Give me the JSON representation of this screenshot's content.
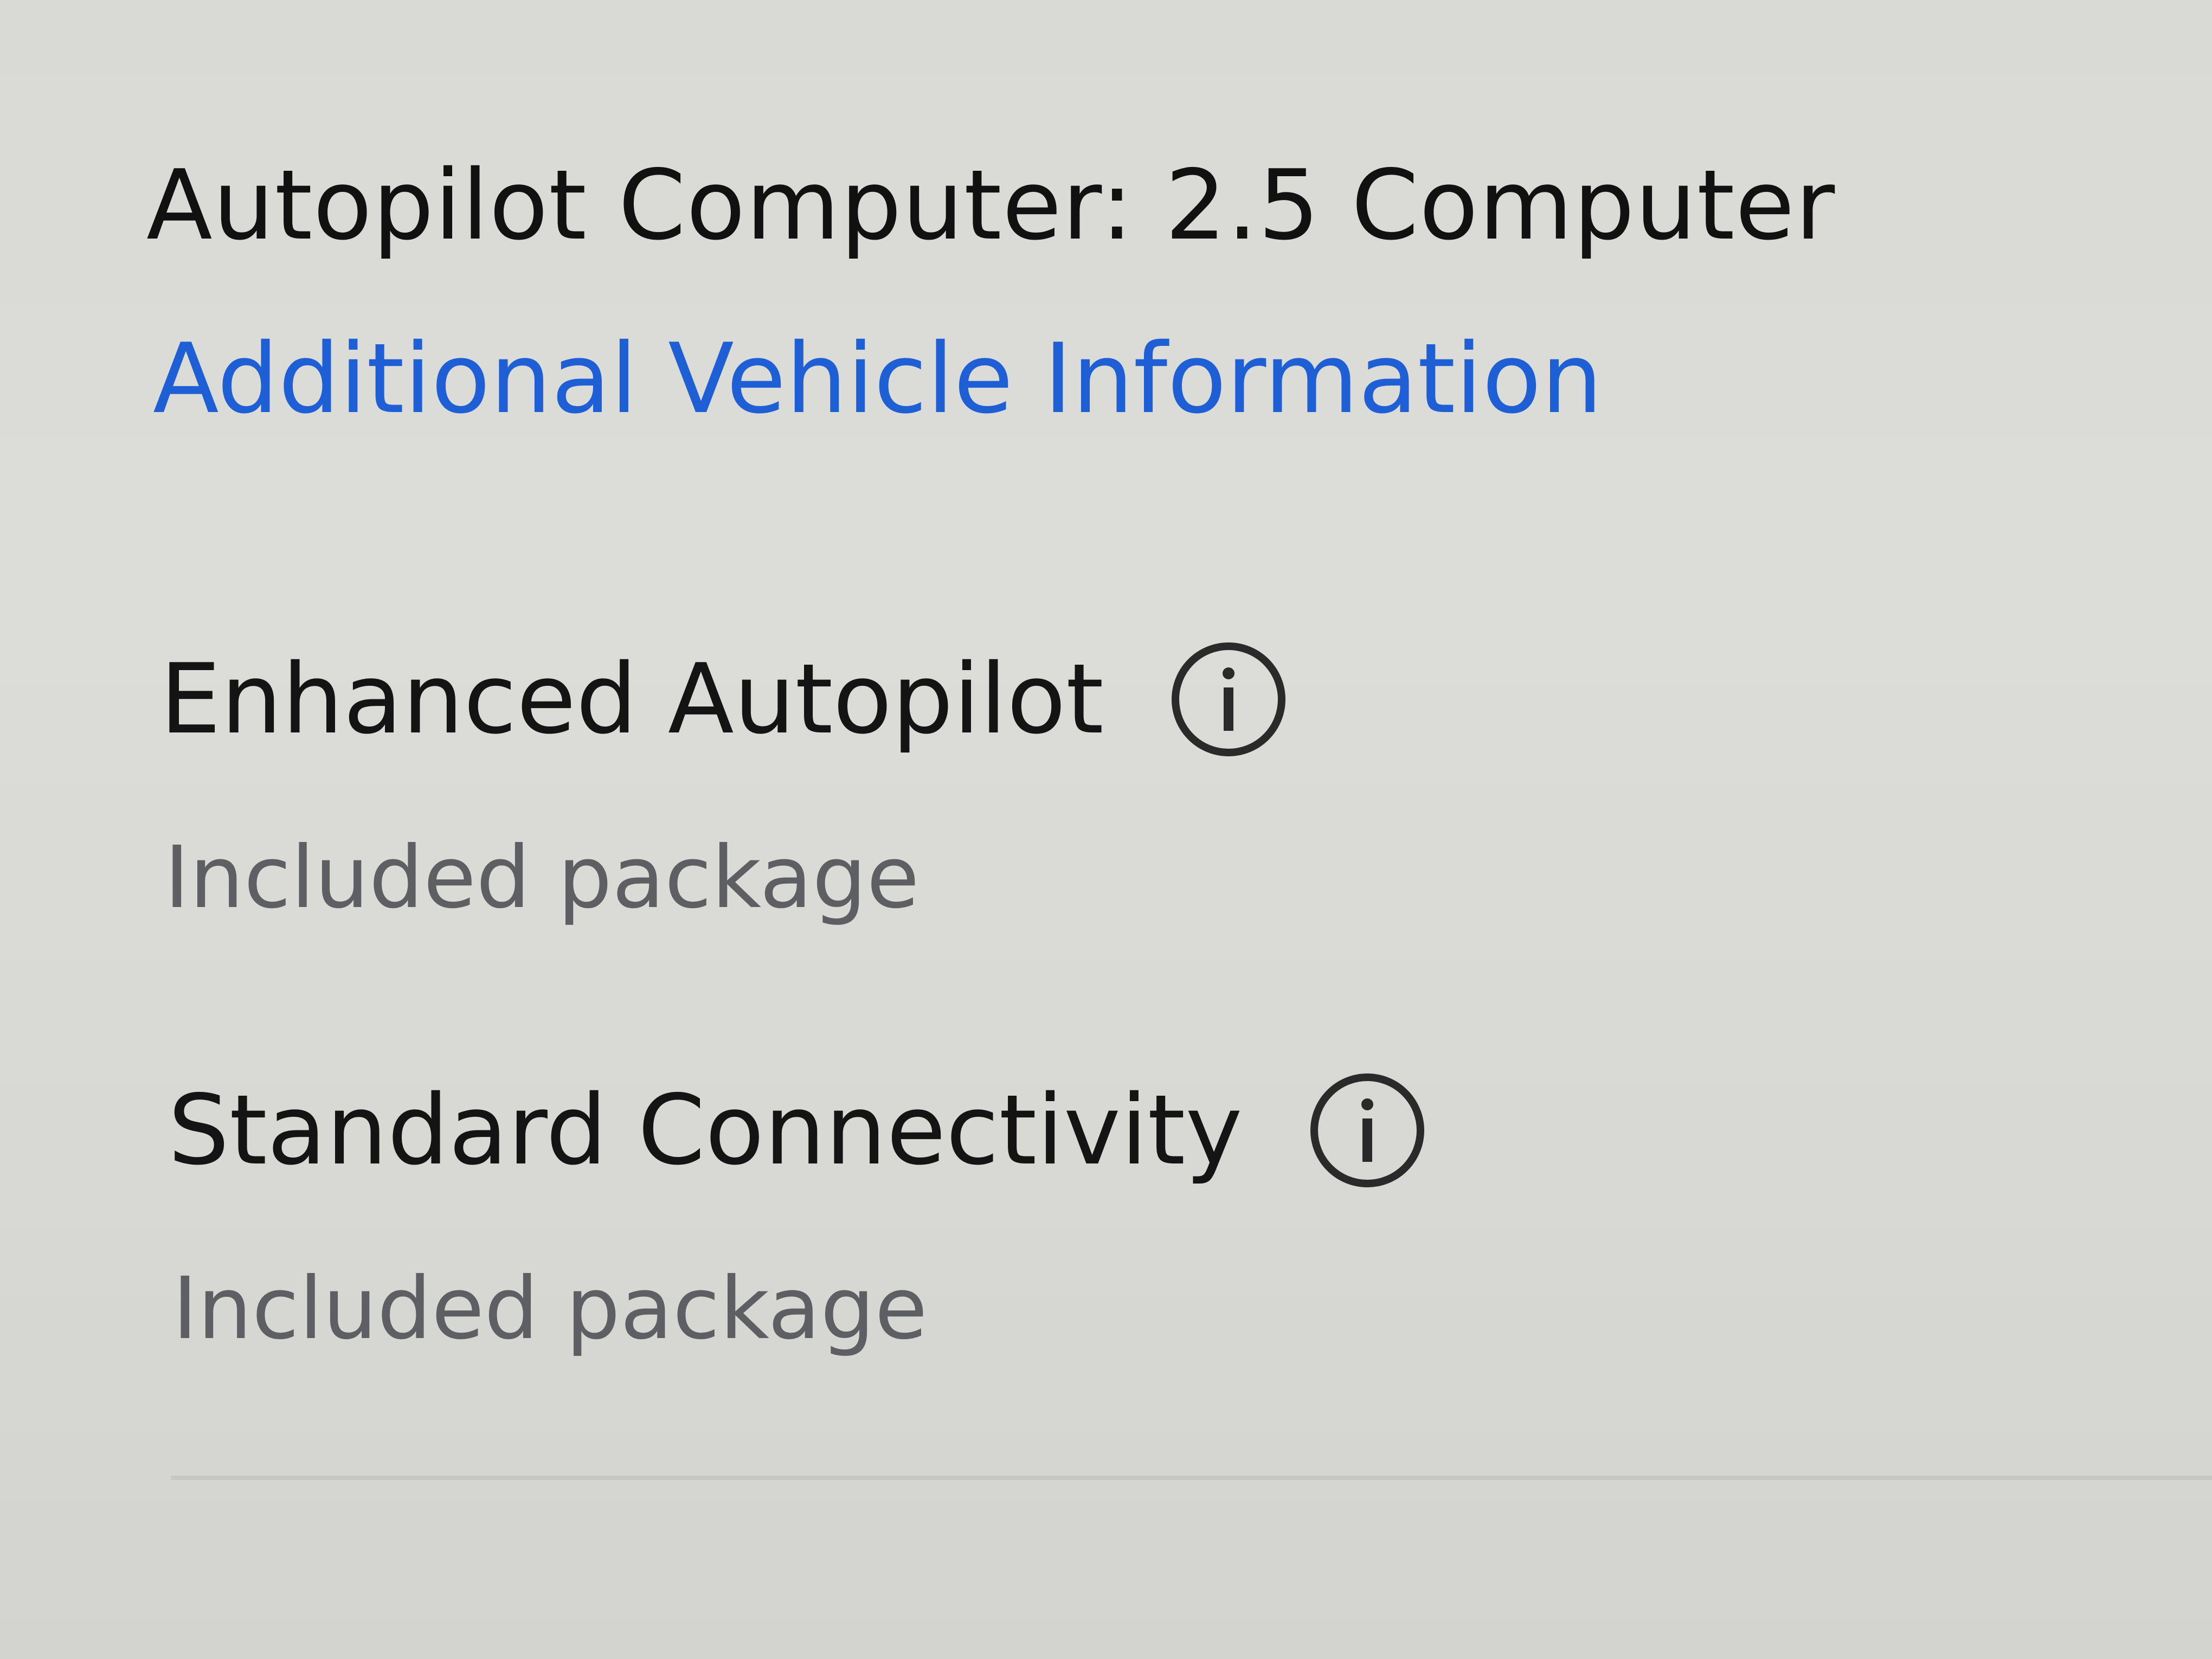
{
  "vehicle_details": {
    "autopilot_computer": "Autopilot Computer: 2.5 Computer",
    "additional_info_link": "Additional Vehicle Information"
  },
  "features": [
    {
      "title": "Enhanced Autopilot",
      "subtitle": "Included package",
      "icon": "info-icon"
    },
    {
      "title": "Standard Connectivity",
      "subtitle": "Included package",
      "icon": "info-icon"
    }
  ],
  "colors": {
    "link": "#1f5fd6",
    "title_text": "#141414",
    "subtitle_text": "#5d5f63",
    "background": "#dadad6"
  }
}
